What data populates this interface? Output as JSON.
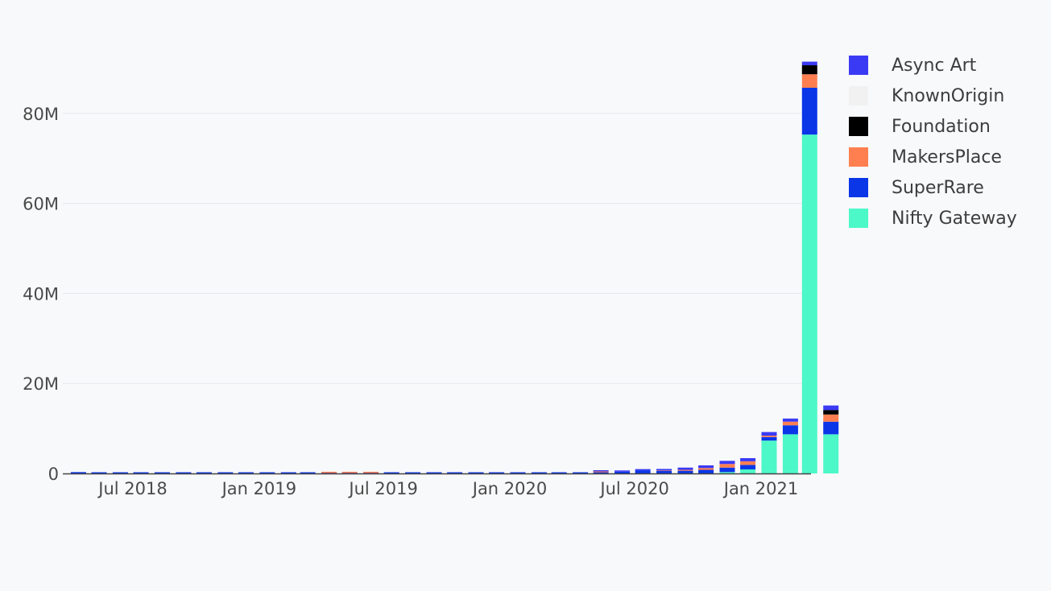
{
  "chart_data": {
    "type": "bar",
    "stacked": true,
    "grid": true,
    "legend_position": "right",
    "ylim": [
      0,
      95000000
    ],
    "y_ticks": [
      {
        "value": 0,
        "label": "0"
      },
      {
        "value": 20000000,
        "label": "20M"
      },
      {
        "value": 40000000,
        "label": "40M"
      },
      {
        "value": 60000000,
        "label": "60M"
      },
      {
        "value": 80000000,
        "label": "80M"
      }
    ],
    "x_ticks": [
      {
        "date": "2018-07-01",
        "label": "Jul 2018"
      },
      {
        "date": "2019-01-01",
        "label": "Jan 2019"
      },
      {
        "date": "2019-07-01",
        "label": "Jul 2019"
      },
      {
        "date": "2020-01-01",
        "label": "Jan 2020"
      },
      {
        "date": "2020-07-01",
        "label": "Jul 2020"
      },
      {
        "date": "2021-01-01",
        "label": "Jan 2021"
      }
    ],
    "categories": [
      "2018-04",
      "2018-05",
      "2018-06",
      "2018-07",
      "2018-08",
      "2018-09",
      "2018-10",
      "2018-11",
      "2018-12",
      "2019-01",
      "2019-02",
      "2019-03",
      "2019-04",
      "2019-05",
      "2019-06",
      "2019-07",
      "2019-08",
      "2019-09",
      "2019-10",
      "2019-11",
      "2019-12",
      "2020-01",
      "2020-02",
      "2020-03",
      "2020-04",
      "2020-05",
      "2020-06",
      "2020-07",
      "2020-08",
      "2020-09",
      "2020-10",
      "2020-11",
      "2020-12",
      "2021-01",
      "2021-02",
      "2021-03",
      "2021-04"
    ],
    "series": [
      {
        "name": "Nifty Gateway",
        "color": "#4cf8c8",
        "values": [
          0,
          0,
          0,
          0,
          0,
          0,
          0,
          0,
          0,
          0,
          0,
          0,
          0,
          0,
          0,
          0,
          0,
          0,
          0,
          0,
          0,
          0,
          0,
          0,
          0,
          0,
          0,
          0,
          0,
          0,
          0,
          300000,
          900000,
          7300000,
          8700000,
          75300000,
          8700000
        ]
      },
      {
        "name": "SuperRare",
        "color": "#0a36e8",
        "values": [
          300000,
          250000,
          100000,
          250000,
          250000,
          250000,
          250000,
          100000,
          250000,
          250000,
          250000,
          250000,
          100000,
          100000,
          100000,
          200000,
          50000,
          50000,
          50000,
          50000,
          50000,
          50000,
          200000,
          200000,
          250000,
          250000,
          400000,
          700000,
          600000,
          600000,
          800000,
          1000000,
          1000000,
          800000,
          2000000,
          10400000,
          2800000
        ]
      },
      {
        "name": "MakersPlace",
        "color": "#ff7f50",
        "values": [
          0,
          0,
          0,
          0,
          0,
          0,
          0,
          0,
          0,
          0,
          0,
          0,
          250000,
          250000,
          250000,
          0,
          0,
          0,
          0,
          0,
          0,
          0,
          0,
          0,
          0,
          200000,
          0,
          0,
          100000,
          200000,
          400000,
          800000,
          800000,
          300000,
          800000,
          3000000,
          1600000
        ]
      },
      {
        "name": "Foundation",
        "color": "#000000",
        "values": [
          0,
          0,
          0,
          0,
          0,
          0,
          0,
          0,
          0,
          0,
          0,
          0,
          0,
          0,
          0,
          0,
          0,
          0,
          0,
          0,
          0,
          0,
          0,
          0,
          0,
          0,
          0,
          0,
          0,
          0,
          0,
          0,
          0,
          0,
          0,
          2000000,
          1000000
        ]
      },
      {
        "name": "KnownOrigin",
        "color": "#f1f1f1",
        "values": [
          0,
          0,
          0,
          0,
          0,
          0,
          0,
          0,
          0,
          0,
          0,
          0,
          0,
          0,
          0,
          0,
          0,
          0,
          0,
          0,
          0,
          0,
          0,
          0,
          0,
          0,
          0,
          0,
          0,
          0,
          0,
          0,
          0,
          0,
          0,
          0,
          0
        ]
      },
      {
        "name": "Async Art",
        "color": "#3a3af5",
        "values": [
          0,
          0,
          0,
          0,
          0,
          0,
          0,
          0,
          0,
          0,
          0,
          0,
          0,
          0,
          0,
          0,
          0,
          0,
          0,
          0,
          0,
          0,
          0,
          0,
          0,
          200000,
          200000,
          200000,
          300000,
          500000,
          600000,
          700000,
          700000,
          800000,
          700000,
          800000,
          1000000
        ]
      }
    ],
    "legend": [
      "Async Art",
      "KnownOrigin",
      "Foundation",
      "MakersPlace",
      "SuperRare",
      "Nifty Gateway"
    ]
  }
}
